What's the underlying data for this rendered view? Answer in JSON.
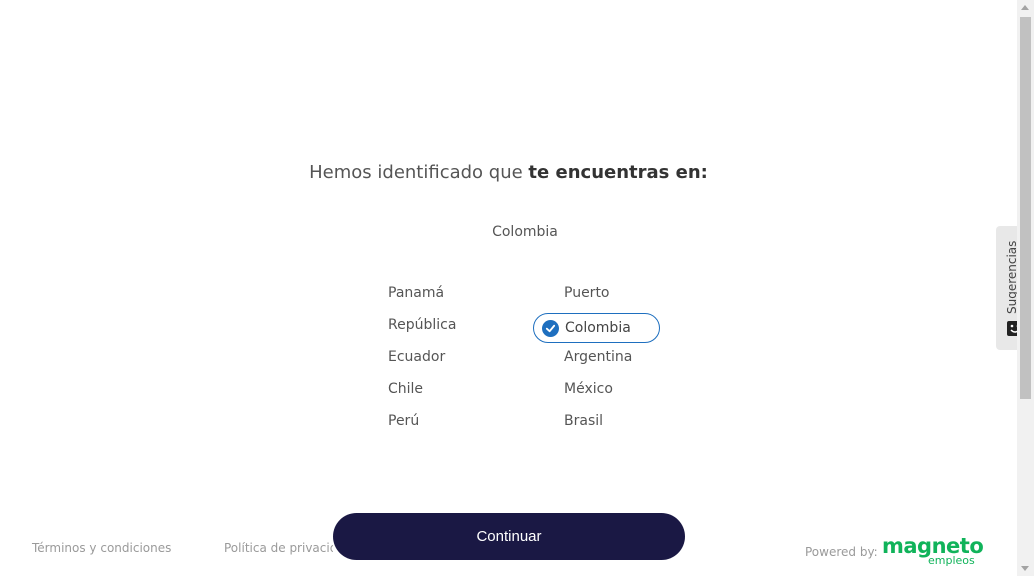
{
  "heading": {
    "prefix": "Hemos identificado que ",
    "emphasis": "te encuentras en:"
  },
  "detected_country": "Colombia",
  "countries_left": [
    "Panamá",
    "República",
    "Ecuador",
    "Chile",
    "Perú"
  ],
  "countries_right": [
    "Puerto",
    "Colombia",
    "Argentina",
    "México",
    "Brasil"
  ],
  "selected_country": "Colombia",
  "continue_label": "Continuar",
  "footer": {
    "terms": "Términos y condiciones",
    "privacy": "Política de privacidad",
    "powered_by": "Powered by:",
    "logo_main": "magneto",
    "logo_sub": "empleos"
  },
  "feedback_tab": {
    "label": "Sugerencias",
    "icon": "smiley-icon"
  },
  "colors": {
    "primary_button": "#1a1844",
    "selected_border": "#1e6fbf",
    "brand_green": "#10b35a"
  }
}
